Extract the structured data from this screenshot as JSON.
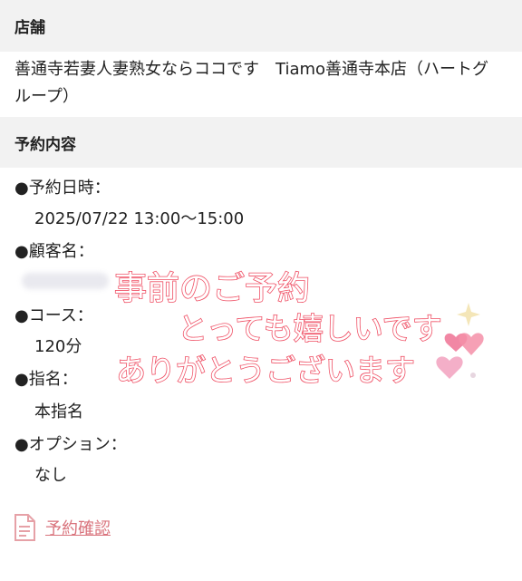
{
  "store": {
    "header": "店舗",
    "text": "善通寺若妻人妻熟女ならココです　Tiamo善通寺本店（ハートグループ）"
  },
  "booking": {
    "header": "予約内容",
    "datetime_label": "●予約日時：",
    "datetime_value": "2025/07/22 13:00〜15:00",
    "customer_label": "●顧客名：",
    "course_label": "●コース：",
    "course_value": "120分",
    "nomination_label": "●指名：",
    "nomination_value": "本指名",
    "option_label": "●オプション：",
    "option_value": "なし"
  },
  "confirm_link": "予約確認",
  "handwritten": {
    "line1": "事前のご予約",
    "line2": "とっても嬉しいです",
    "line3": "ありがとうございます"
  },
  "colors": {
    "header_bg": "#f2f2f2",
    "link": "#d9737c",
    "handwriting_stroke": "#ef4f64",
    "heart": "#f07a9a"
  },
  "icons": [
    "document-icon",
    "heart-icon",
    "sparkle-icon"
  ]
}
